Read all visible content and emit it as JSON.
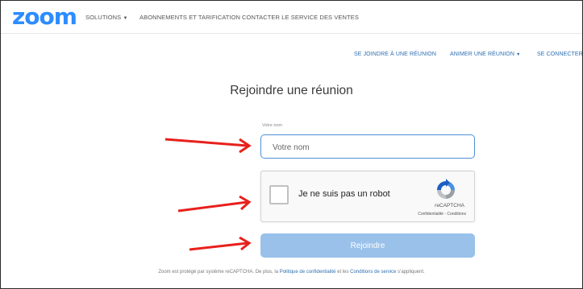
{
  "header": {
    "logo": "zoom",
    "nav": {
      "solutions": "SOLUTIONS",
      "pricing": "ABONNEMENTS ET TARIFICATION",
      "contact": "CONTACTER LE SERVICE DES VENTES"
    },
    "subnav": {
      "join": "SE JOINDRE À UNE RÉUNION",
      "host": "ANIMER UNE RÉUNION",
      "signin": "SE CONNECTER"
    }
  },
  "main": {
    "title": "Rejoindre une réunion",
    "name_label": "Votre nom",
    "name_placeholder": "Votre nom",
    "name_value": "",
    "captcha": {
      "label": "Je ne suis pas un robot",
      "brand": "reCAPTCHA",
      "privacy": "Confidentialité",
      "separator": " - ",
      "terms": "Conditions"
    },
    "join_button": "Rejoindre"
  },
  "footer": {
    "text1": "Zoom est protégé par système reCAPTCHA. De plus, la ",
    "privacy_link": "Politique de confidentialité",
    "text2": " et les ",
    "terms_link": "Conditions de service",
    "text3": " s'appliquent."
  },
  "colors": {
    "brand": "#2d8cff",
    "link": "#2d6fb0",
    "button": "#99c1ea",
    "input_border": "#4d8fd6",
    "annotation_arrow": "#e8201c"
  },
  "icons": [
    "caret-down-icon",
    "recaptcha-logo-icon",
    "red-arrow-icon"
  ]
}
